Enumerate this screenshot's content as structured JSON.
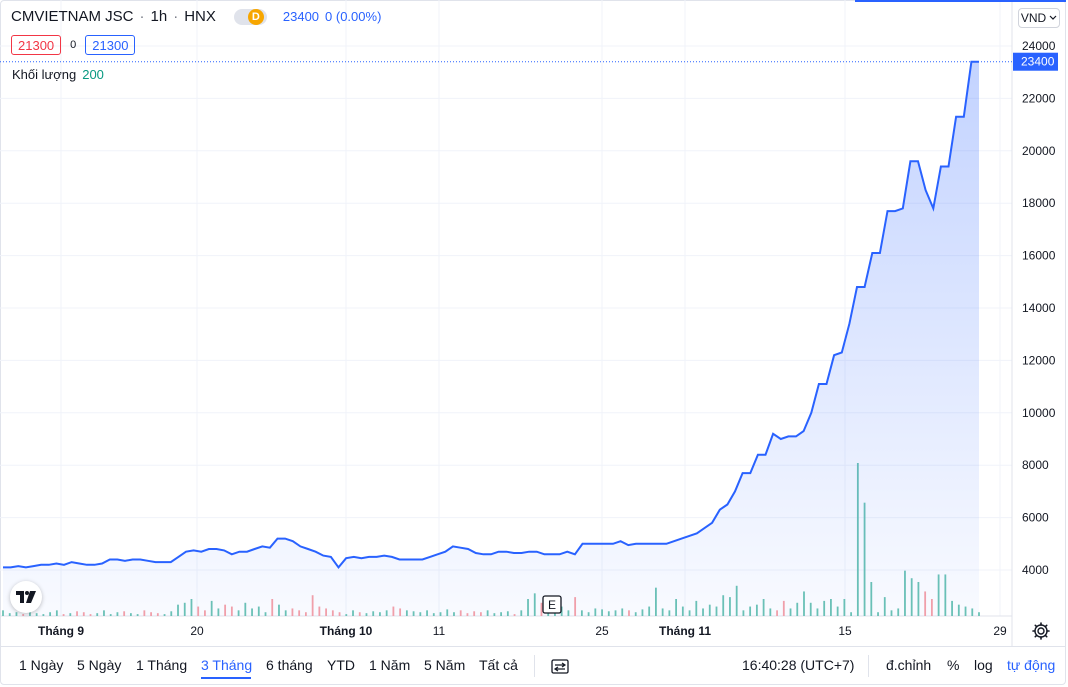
{
  "header": {
    "symbol": "CMVIETNAM JSC",
    "interval": "1h",
    "exchange": "HNX",
    "session_badge": "D",
    "last_price": "23400",
    "change": "0 (0.00%)",
    "sell_price": "21300",
    "spread": "0",
    "buy_price": "21300",
    "currency": "VND"
  },
  "volume_legend": {
    "label": "Khối lượng",
    "value": "200"
  },
  "event_marker": "E",
  "logo": "TV",
  "colors": {
    "line": "#2962ff",
    "up": "#22ab94",
    "down": "#f23645",
    "accent": "#2962ff"
  },
  "chart_data": {
    "type": "area",
    "y_unit": "VND",
    "ylim": [
      3000,
      24600
    ],
    "y_ticks": [
      4000,
      6000,
      8000,
      10000,
      12000,
      14000,
      16000,
      18000,
      20000,
      22000,
      24000
    ],
    "last_price_label": "23400",
    "x_tick_labels": [
      "Tháng 9",
      "20",
      "Tháng 10",
      "11",
      "25",
      "Tháng 11",
      "15",
      "29"
    ],
    "series": [
      {
        "values": [
          4100,
          4100,
          4150,
          4100,
          4150,
          4200,
          4200,
          4250,
          4200,
          4300,
          4250,
          4200,
          4200,
          4250,
          4400,
          4400,
          4350,
          4400,
          4400,
          4350,
          4300,
          4300,
          4300,
          4500,
          4700,
          4750,
          4700,
          4800,
          4800,
          4750,
          4600,
          4700,
          4700,
          4800,
          4900,
          4850,
          5200,
          5200,
          5100,
          4900,
          4800,
          4700,
          4550,
          4500,
          4100,
          4450,
          4500,
          4450,
          4500,
          4500,
          4550,
          4500,
          4400,
          4400,
          4400,
          4400,
          4500,
          4600,
          4700,
          4900,
          4850,
          4800,
          4650,
          4600,
          4600,
          4700,
          4700,
          4650,
          4650,
          4700,
          4700,
          4600,
          4600,
          4600,
          4700,
          4600,
          5000,
          5000,
          5000,
          5000,
          5000,
          5100,
          4950,
          5000,
          5000,
          5000,
          5000,
          5000,
          5100,
          5200,
          5300,
          5400,
          5600,
          5800,
          6300,
          6500,
          7000,
          7700,
          7700,
          8400,
          8400,
          9200,
          9000,
          9100,
          9100,
          9300,
          10000,
          11100,
          11100,
          12200,
          12300,
          13400,
          14800,
          14800,
          16100,
          16100,
          17700,
          17700,
          17800,
          19600,
          19600,
          18500,
          17800,
          19400,
          19400,
          21300,
          21300,
          23400,
          23400
        ]
      },
      {
        "name": "Khối lượng",
        "values": [
          300,
          150,
          200,
          100,
          250,
          150,
          100,
          200,
          300,
          100,
          150,
          250,
          200,
          100,
          150,
          300,
          100,
          200,
          250,
          150,
          100,
          300,
          200,
          150,
          100,
          250,
          600,
          700,
          900,
          500,
          300,
          800,
          400,
          600,
          500,
          300,
          700,
          400,
          500,
          200,
          900,
          600,
          300,
          400,
          300,
          200,
          1100,
          500,
          400,
          300,
          200,
          100,
          300,
          200,
          150,
          250,
          200,
          300,
          500,
          400,
          300,
          250,
          200,
          300,
          150,
          200,
          350,
          200,
          300,
          150,
          250,
          200,
          300,
          150,
          200,
          250,
          100,
          300,
          900,
          1200,
          700,
          400,
          600,
          500,
          300,
          1000,
          300,
          200,
          400,
          350,
          250,
          300,
          400,
          300,
          200,
          350,
          500,
          1500,
          400,
          300,
          900,
          500,
          300,
          800,
          400,
          600,
          500,
          1100,
          1000,
          1600,
          300,
          500,
          600,
          900,
          400,
          300,
          800,
          400,
          700,
          1300,
          700,
          400,
          800,
          900,
          500,
          900,
          200,
          8100,
          6000,
          1800,
          200,
          1000,
          300,
          400,
          2400,
          2000,
          1800,
          1300,
          900,
          2200,
          2200,
          800,
          600,
          500,
          400,
          200
        ]
      }
    ]
  },
  "footer": {
    "ranges": [
      "1 Ngày",
      "5 Ngày",
      "1 Tháng",
      "3 Tháng",
      "6 tháng",
      "YTD",
      "1 Năm",
      "5 Năm",
      "Tất cả"
    ],
    "active_range": "3 Tháng",
    "time": "16:40:28 (UTC+7)",
    "adjust": "đ.chỉnh",
    "percent": "%",
    "log": "log",
    "auto": "tự động"
  }
}
